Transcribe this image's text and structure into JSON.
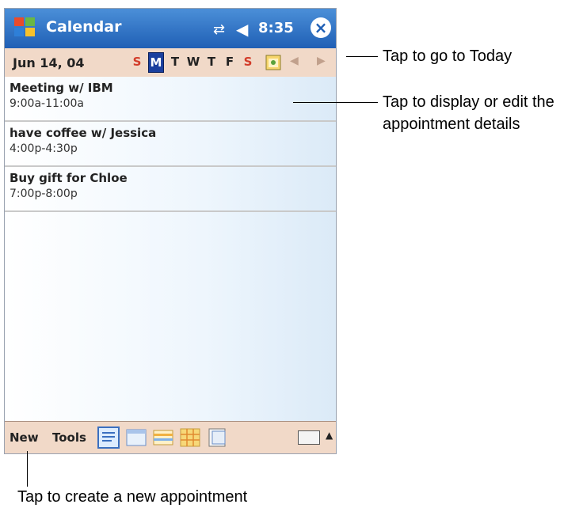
{
  "titlebar": {
    "title": "Calendar",
    "time": "8:35",
    "close_label": "×"
  },
  "datebar": {
    "date": "Jun 14, 04",
    "weekdays": [
      "S",
      "M",
      "T",
      "W",
      "T",
      "F",
      "S"
    ]
  },
  "appointments": [
    {
      "title": "Meeting w/ IBM",
      "time": "9:00a-11:00a"
    },
    {
      "title": "have coffee w/ Jessica",
      "time": "4:00p-4:30p"
    },
    {
      "title": "Buy gift for Chloe",
      "time": "7:00p-8:00p"
    }
  ],
  "bottombar": {
    "new": "New",
    "tools": "Tools"
  },
  "callouts": {
    "today": "Tap to go to Today",
    "details_line1": "Tap to display or edit the",
    "details_line2": "appointment details",
    "new_appt": "Tap to create a new appointment"
  }
}
